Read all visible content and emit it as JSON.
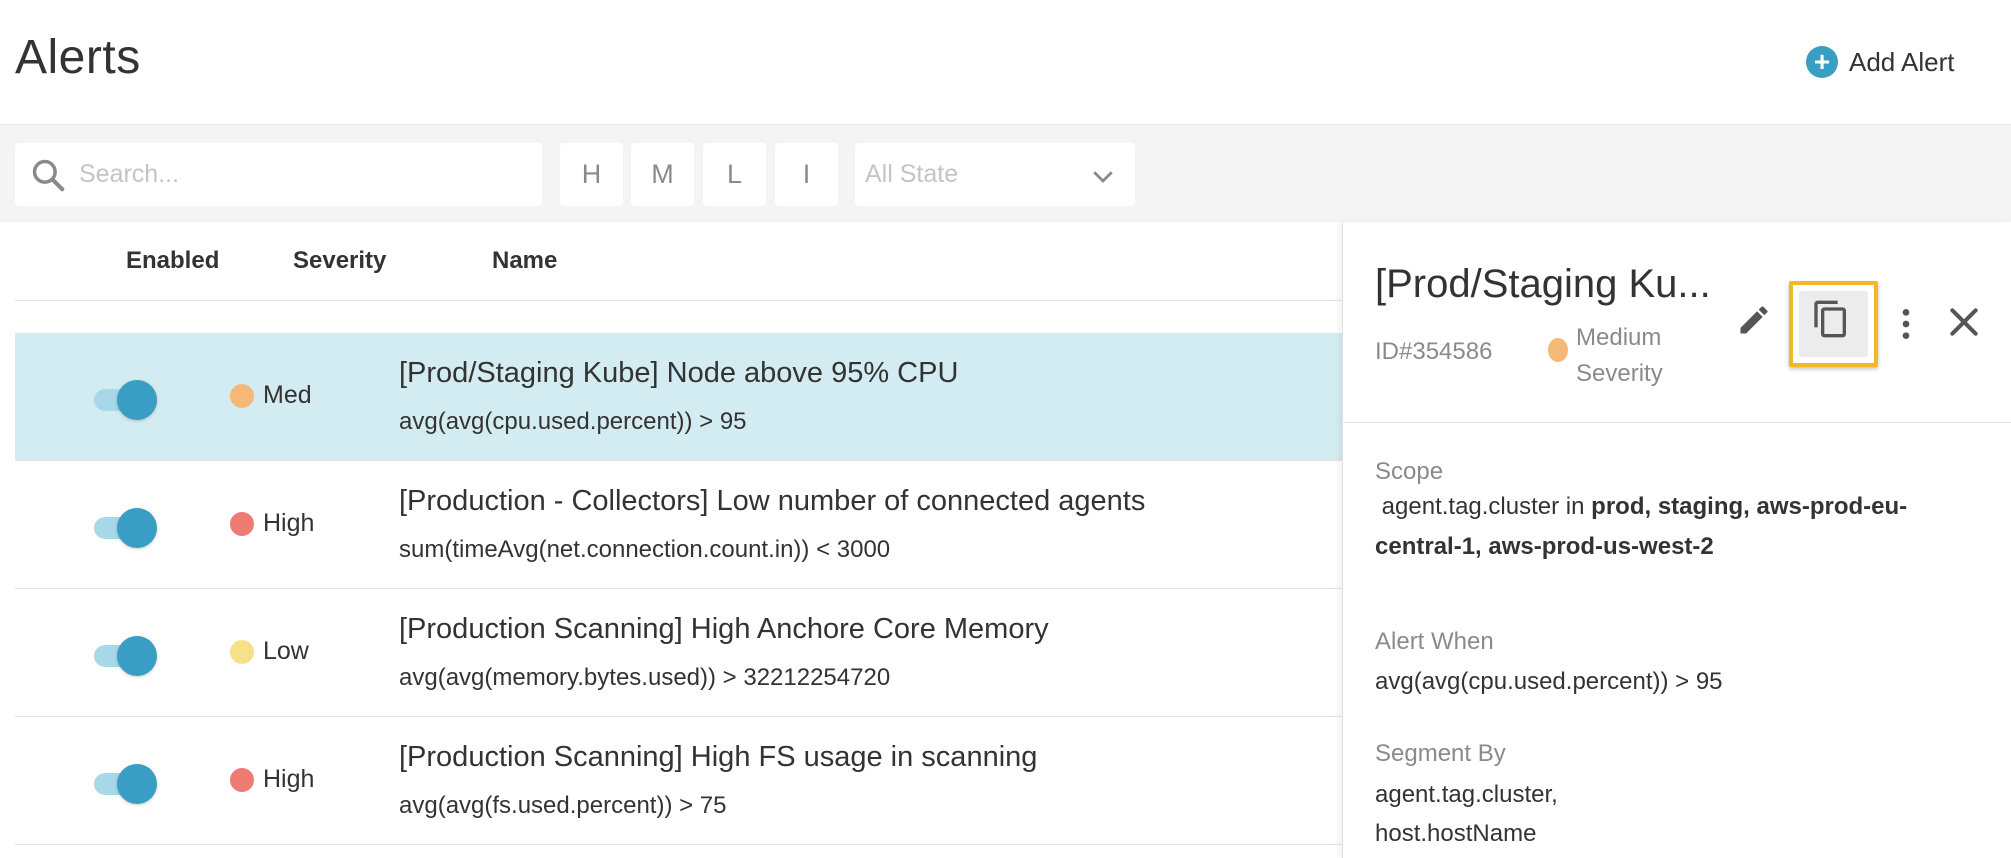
{
  "header": {
    "title": "Alerts",
    "add_button": "Add Alert"
  },
  "filters": {
    "search_placeholder": "Search...",
    "severity_buttons": [
      "H",
      "M",
      "L",
      "I"
    ],
    "state_select": "All State"
  },
  "table": {
    "columns": {
      "enabled": "Enabled",
      "severity": "Severity",
      "name": "Name"
    },
    "rows": [
      {
        "enabled": true,
        "severity": "Med",
        "severity_color": "#f5b877",
        "name": "[Prod/Staging Kube] Node above 95% CPU",
        "condition": "avg(avg(cpu.used.percent)) > 95",
        "selected": true
      },
      {
        "enabled": true,
        "severity": "High",
        "severity_color": "#ee7b72",
        "name": "[Production - Collectors] Low number of connected agents",
        "condition": "sum(timeAvg(net.connection.count.in)) < 3000",
        "selected": false
      },
      {
        "enabled": true,
        "severity": "Low",
        "severity_color": "#f8e08a",
        "name": "[Production Scanning] High Anchore Core Memory",
        "condition": "avg(avg(memory.bytes.used)) > 32212254720",
        "selected": false
      },
      {
        "enabled": true,
        "severity": "High",
        "severity_color": "#ee7b72",
        "name": "[Production Scanning] High FS usage in scanning",
        "condition": "avg(avg(fs.used.percent)) > 75",
        "selected": false
      }
    ]
  },
  "panel": {
    "title": "[Prod/Staging Ku...",
    "id": "ID#354586",
    "severity": "Medium Severity",
    "scope_label": "Scope",
    "scope_key": "agent.tag.cluster",
    "scope_op": "in",
    "scope_values": "prod, staging, aws-prod-eu-central-1, aws-prod-us-west-2",
    "alert_when_label": "Alert When",
    "alert_when": "avg(avg(cpu.used.percent)) > 95",
    "segment_by_label": "Segment By",
    "segment_by_1": "agent.tag.cluster,",
    "segment_by_2": "host.hostName"
  },
  "colors": {
    "accent": "#3a9dc4",
    "selected_row": "#d3ecf2",
    "highlight": "#f3b82a"
  }
}
